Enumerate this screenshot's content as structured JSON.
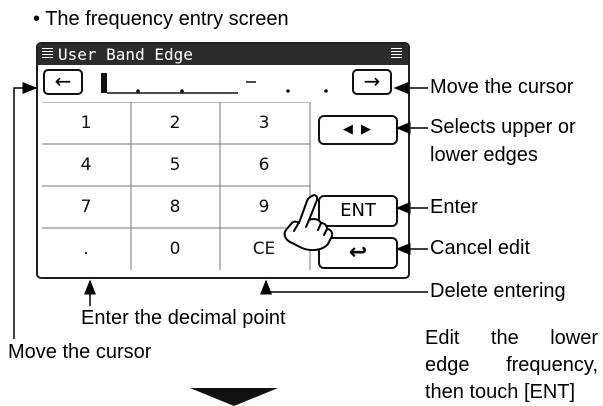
{
  "heading": "• The frequency entry screen",
  "screen": {
    "title": "User Band Edge",
    "left_arrow": "←",
    "right_arrow": "→",
    "frequency_mask": "_ . . _ - . . .",
    "keypad": [
      "1",
      "2",
      "3",
      "4",
      "5",
      "6",
      "7",
      "8",
      "9",
      ".",
      "0",
      "CE"
    ],
    "side_buttons": {
      "edge_select": "◀ ▶",
      "enter": "ENT",
      "cancel": "↩"
    }
  },
  "callouts": {
    "move_cursor_right": "Move the cursor",
    "select_edges_1": "Selects upper or",
    "select_edges_2": "lower edges",
    "enter": "Enter",
    "cancel_edit": "Cancel edit",
    "delete_entering": "Delete entering",
    "enter_decimal": "Enter the decimal point",
    "move_cursor_left": "Move the cursor"
  },
  "note": {
    "line1_a": "Edit",
    "line1_b": "the",
    "line1_c": "lower",
    "line2_a": "edge",
    "line2_b": "frequency,",
    "line3": "then touch [ENT]"
  },
  "colors": {
    "screen_border": "#1e1e1e",
    "titlebar": "#2b2b2b",
    "grid_line": "#777777"
  },
  "icons": {
    "next_step": "down-triangle-icon",
    "touch": "hand-pointer-icon"
  }
}
